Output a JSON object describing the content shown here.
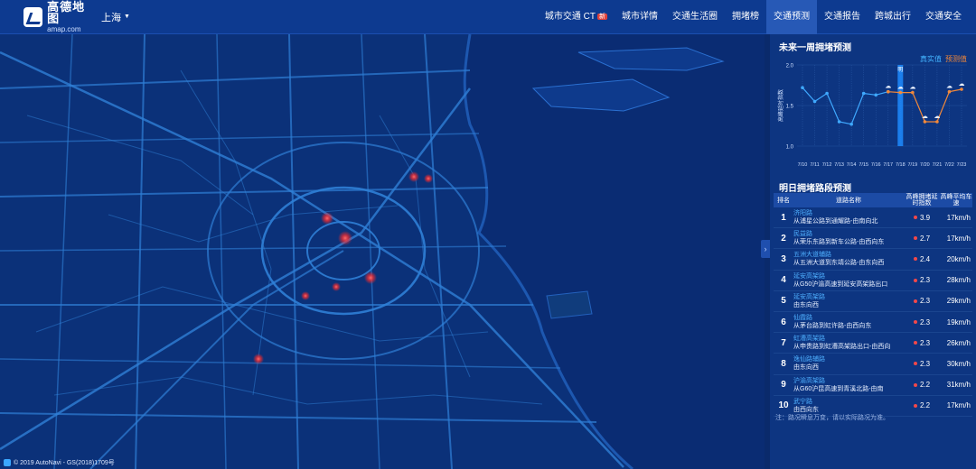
{
  "header": {
    "logo_cn": "高德地图",
    "logo_en": "amap.com",
    "city": "上海",
    "nav": [
      {
        "label": "城市交通 CT",
        "badge": "新",
        "active": false
      },
      {
        "label": "城市详情",
        "active": false
      },
      {
        "label": "交通生活圈",
        "active": false
      },
      {
        "label": "拥堵榜",
        "active": false
      },
      {
        "label": "交通预测",
        "active": true
      },
      {
        "label": "交通报告",
        "active": false
      },
      {
        "label": "跨城出行",
        "active": false
      },
      {
        "label": "交通安全",
        "active": false
      }
    ]
  },
  "map": {
    "copyright": "© 2019 AutoNavi - GS(2018)1709号"
  },
  "forecast": {
    "title": "未来一周拥堵预测",
    "legend_real": "真实值",
    "legend_pred": "预测值",
    "today_label": "明",
    "chart_data": {
      "type": "line",
      "categories": [
        "7/10",
        "7/11",
        "7/12",
        "7/13",
        "7/14",
        "7/15",
        "7/16",
        "7/17",
        "7/18",
        "7/19",
        "7/20",
        "7/21",
        "7/22",
        "7/23"
      ],
      "ylabel": "高峰延时指数",
      "ylim": [
        1.0,
        2.0
      ],
      "yticks": [
        1.0,
        1.5,
        2.0
      ],
      "highlight_index": 8,
      "series": [
        {
          "name": "真实值",
          "values": [
            1.72,
            1.55,
            1.65,
            1.3,
            1.27,
            1.65,
            1.63,
            1.67,
            null,
            null,
            null,
            null,
            null,
            null
          ]
        },
        {
          "name": "预测值",
          "values": [
            null,
            null,
            null,
            null,
            null,
            null,
            null,
            1.67,
            1.66,
            1.66,
            1.3,
            1.3,
            1.67,
            1.7
          ]
        }
      ]
    }
  },
  "tomorrow": {
    "title": "明日拥堵路段预测",
    "columns": {
      "rank": "排名",
      "name": "道路名称",
      "index": "高峰拥堵延时指数",
      "speed": "高峰平均车速"
    },
    "rows": [
      {
        "rank": "1",
        "road": "济阳路",
        "segment": "从浦星公路到通耀路-由南向北",
        "index": "3.9",
        "speed": "17km/h"
      },
      {
        "rank": "2",
        "road": "民益路",
        "segment": "从荣乐东路到新车公路-由西向东",
        "index": "2.7",
        "speed": "17km/h"
      },
      {
        "rank": "3",
        "road": "五洲大道辅路",
        "segment": "从五洲大道到东靖公路-由东向西",
        "index": "2.4",
        "speed": "20km/h"
      },
      {
        "rank": "4",
        "road": "延安高架路",
        "segment": "从G50沪渝高速到延安高架路出口",
        "index": "2.3",
        "speed": "28km/h"
      },
      {
        "rank": "5",
        "road": "延安高架路",
        "segment": "由东向西",
        "index": "2.3",
        "speed": "29km/h"
      },
      {
        "rank": "6",
        "road": "仙霞路",
        "segment": "从茅台路到虹许路-由西向东",
        "index": "2.3",
        "speed": "19km/h"
      },
      {
        "rank": "7",
        "road": "虹漕高架路",
        "segment": "从申贵路到虹漕高架路出口-由西向",
        "index": "2.3",
        "speed": "26km/h"
      },
      {
        "rank": "8",
        "road": "逸仙路辅路",
        "segment": "由东向西",
        "index": "2.3",
        "speed": "30km/h"
      },
      {
        "rank": "9",
        "road": "沪渝高架路",
        "segment": "从G60沪昆高速到青溪北路-由南",
        "index": "2.2",
        "speed": "31km/h"
      },
      {
        "rank": "10",
        "road": "武宁路",
        "segment": "由西向东",
        "index": "2.2",
        "speed": "17km/h"
      }
    ],
    "note": "注：路况瞬息万变，请以实际路况为准。"
  },
  "colors": {
    "real": "#3fa9ff",
    "pred": "#f1883a",
    "hotspot": "#ff3b3b",
    "road": "#2f7fd6"
  }
}
